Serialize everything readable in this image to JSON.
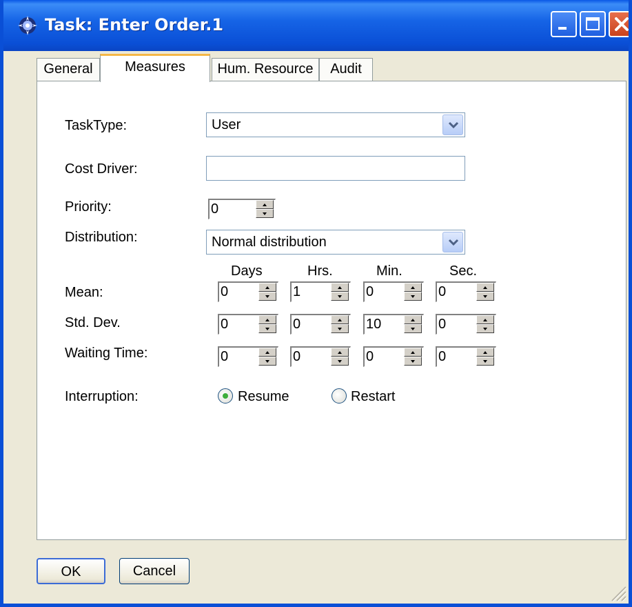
{
  "window": {
    "title": "Task: Enter Order.1",
    "app_icon": "gear-sparkle-icon",
    "controls": [
      "minimize-icon",
      "maximize-icon",
      "close-icon"
    ]
  },
  "tabs": [
    {
      "label": "General",
      "active": false
    },
    {
      "label": "Measures",
      "active": true
    },
    {
      "label": "Hum. Resource",
      "active": false
    },
    {
      "label": "Audit",
      "active": false
    }
  ],
  "form": {
    "task_type": {
      "label": "TaskType:",
      "value": "User"
    },
    "cost_driver": {
      "label": "Cost Driver:",
      "value": ""
    },
    "priority": {
      "label": "Priority:",
      "value": "0"
    },
    "distribution": {
      "label": "Distribution:",
      "value": "Normal distribution"
    },
    "time_headers": [
      "Days",
      "Hrs.",
      "Min.",
      "Sec."
    ],
    "mean": {
      "label": "Mean:",
      "values": [
        "0",
        "1",
        "0",
        "0"
      ]
    },
    "std_dev": {
      "label": "Std. Dev.",
      "values": [
        "0",
        "0",
        "10",
        "0"
      ]
    },
    "waiting_time": {
      "label": "Waiting Time:",
      "values": [
        "0",
        "0",
        "0",
        "0"
      ]
    },
    "interruption": {
      "label": "Interruption:",
      "options": [
        {
          "label": "Resume",
          "selected": true
        },
        {
          "label": "Restart",
          "selected": false
        }
      ]
    }
  },
  "buttons": {
    "ok": "OK",
    "cancel": "Cancel"
  },
  "colors": {
    "titlebar": "#0a4fd6",
    "dialog_bg": "#ece9d8",
    "active_tab_accent": "#f5b746",
    "radio_selected": "#3eae3b",
    "close_button": "#c9421d"
  }
}
